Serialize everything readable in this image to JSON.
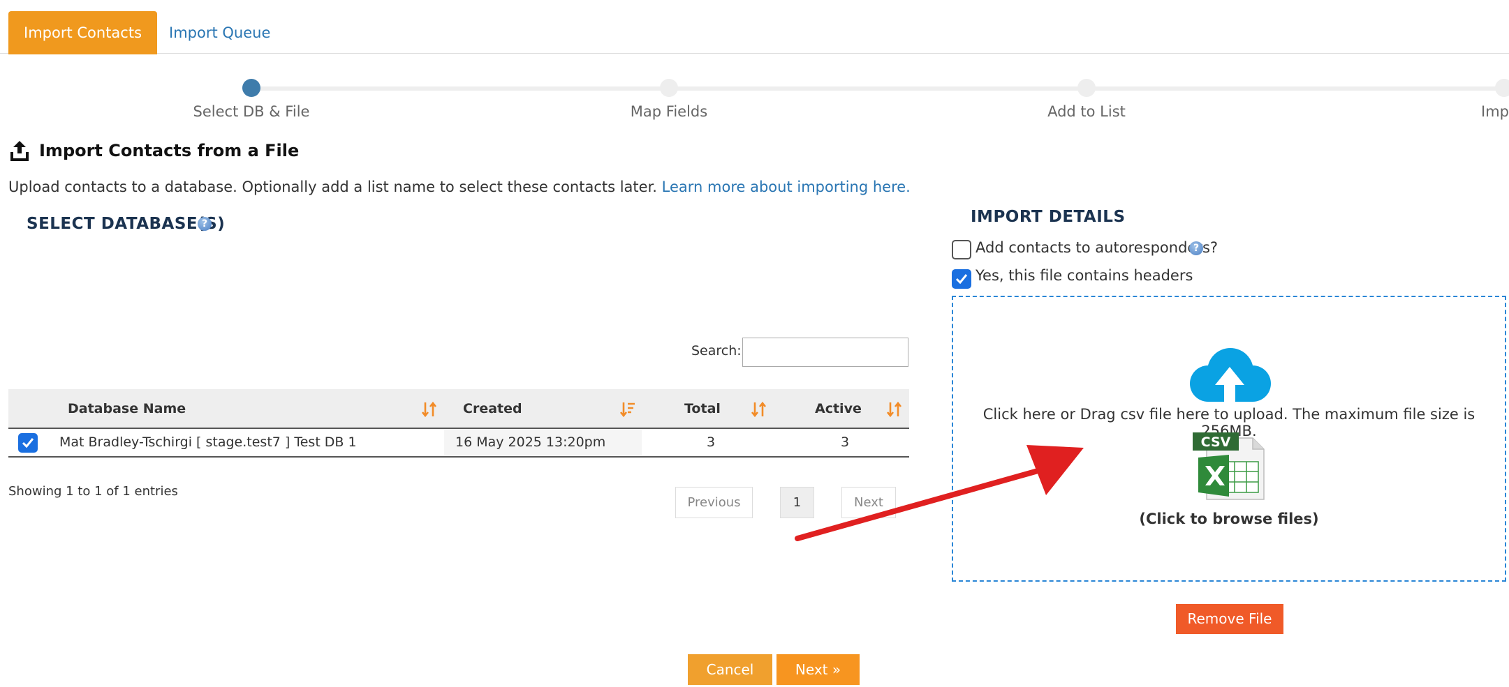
{
  "tabs": [
    {
      "label": "Import Contacts"
    },
    {
      "label": "Import Queue"
    }
  ],
  "steps": [
    {
      "label": "Select DB & File"
    },
    {
      "label": "Map Fields"
    },
    {
      "label": "Add to List"
    },
    {
      "label": "Imp"
    }
  ],
  "heading": {
    "title": "Import Contacts from a File",
    "intro_text": "Upload contacts to a database. Optionally add a list name to select these contacts later.",
    "intro_link": "Learn more about importing here."
  },
  "databases": {
    "title": "SELECT DATABASE(S)",
    "search_label": "Search:",
    "search_value": "",
    "columns": [
      "Database Name",
      "Created",
      "Total",
      "Active"
    ],
    "rows": [
      {
        "name": "Mat Bradley-Tschirgi [ stage.test7 ] Test DB 1",
        "created": "16 May 2025 13:20pm",
        "total": "3",
        "active": "3"
      }
    ],
    "info": "Showing 1 to 1 of 1 entries",
    "pagination": {
      "previous": "Previous",
      "page": "1",
      "next": "Next"
    }
  },
  "import_details": {
    "title": "IMPORT DETAILS",
    "autoresponders_label": "Add contacts to autoresponders?",
    "headers_label": "Yes, this file contains headers",
    "dropzone_text": "Click here or Drag csv file here to upload. The maximum file size is 256MB.",
    "browse_text": "(Click to browse files)",
    "csv_badge": "CSV",
    "remove_button": "Remove File"
  },
  "footer": {
    "cancel": "Cancel",
    "next": "Next »"
  },
  "colors": {
    "accent_orange": "#f0991e",
    "link_blue": "#2a76b3",
    "step_active": "#3f7cab",
    "checkbox_blue": "#1a6fe0",
    "remove_red": "#f05a28",
    "arrow_red": "#e02020"
  }
}
